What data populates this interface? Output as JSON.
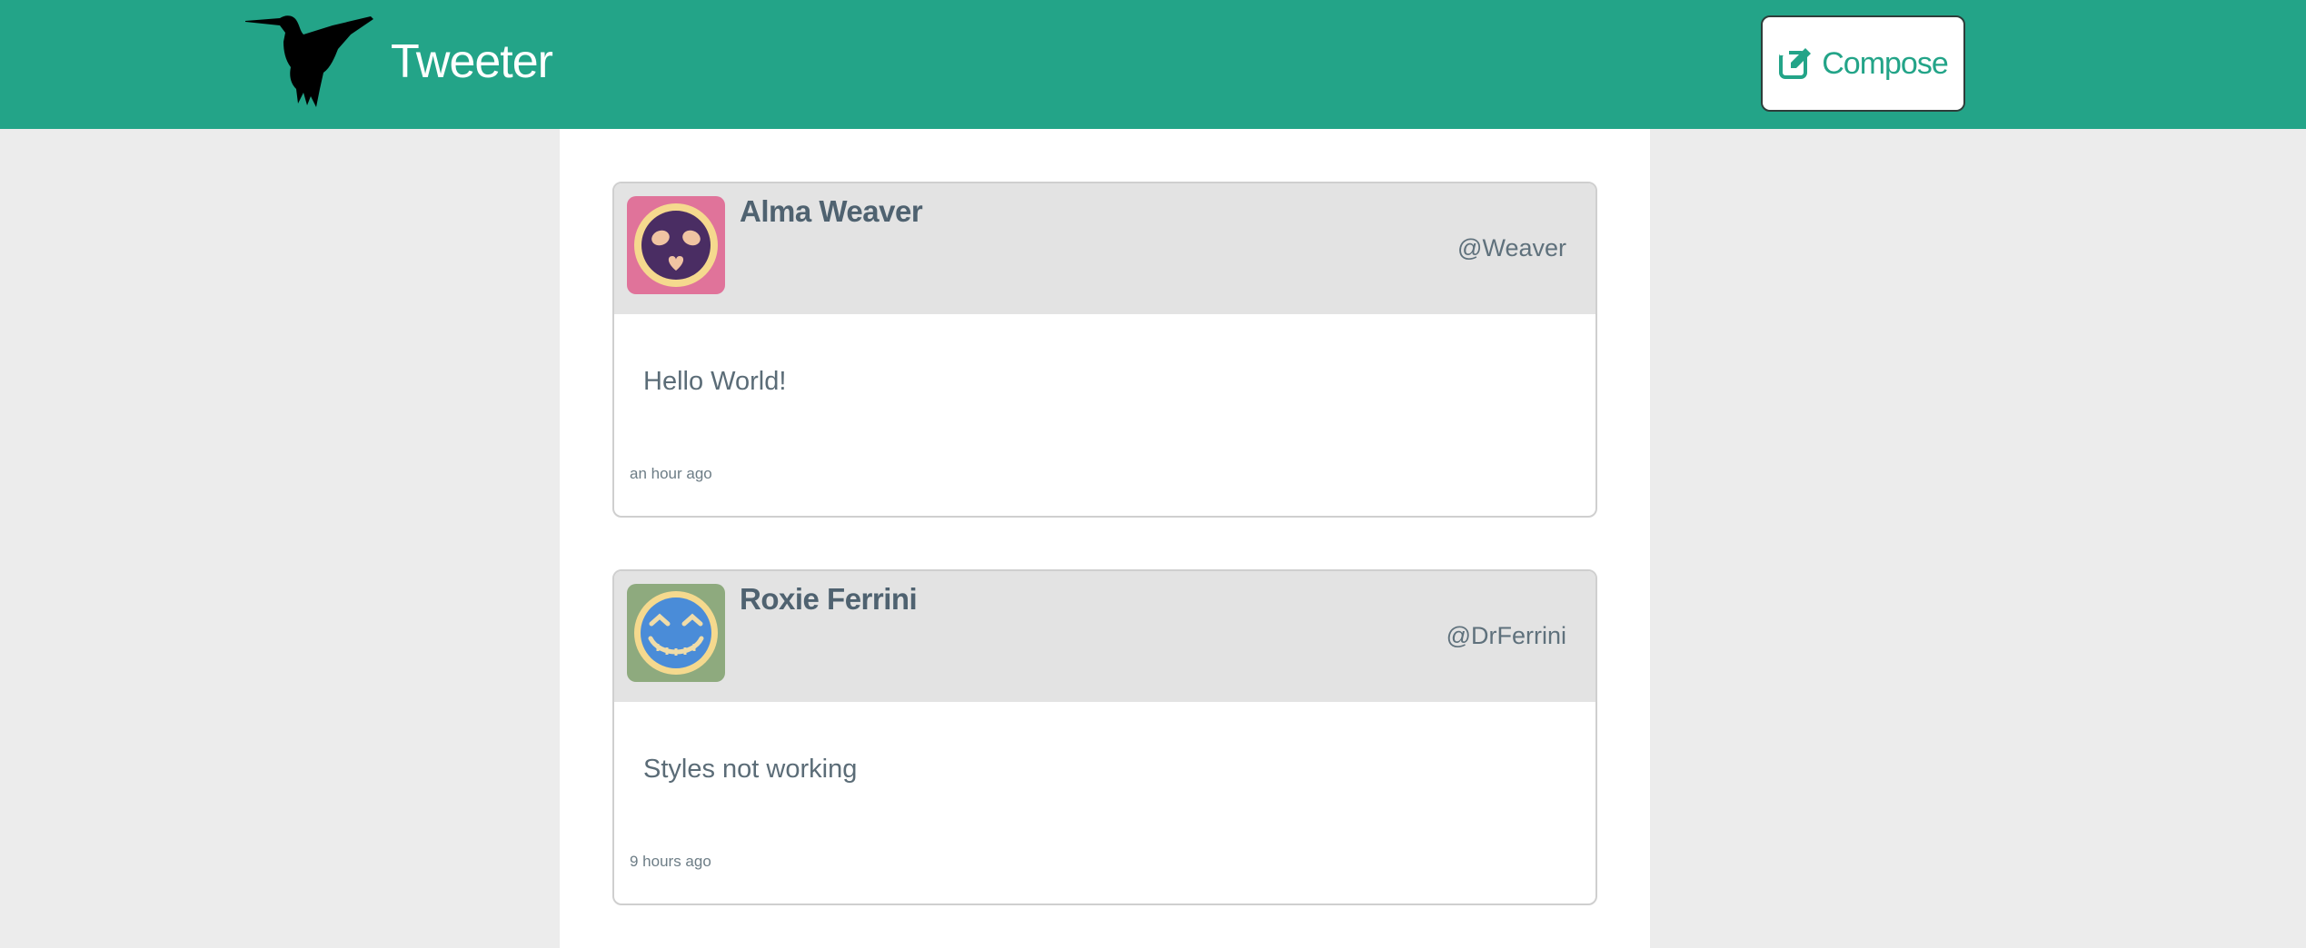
{
  "app": {
    "title": "Tweeter",
    "logo_icon": "hummingbird-icon"
  },
  "header": {
    "compose_label": "Compose",
    "compose_icon": "edit-icon"
  },
  "colors": {
    "brand": "#23a488",
    "card_header": "#e3e3e3",
    "text": "#4f6270"
  },
  "tweets": [
    {
      "name": "Alma Weaver",
      "handle": "@Weaver",
      "text": "Hello World!",
      "time": "an hour ago",
      "avatar_icon": "pink-avatar-icon"
    },
    {
      "name": "Roxie Ferrini",
      "handle": "@DrFerrini",
      "text": "Styles not working",
      "time": "9 hours ago",
      "avatar_icon": "green-avatar-icon"
    }
  ]
}
